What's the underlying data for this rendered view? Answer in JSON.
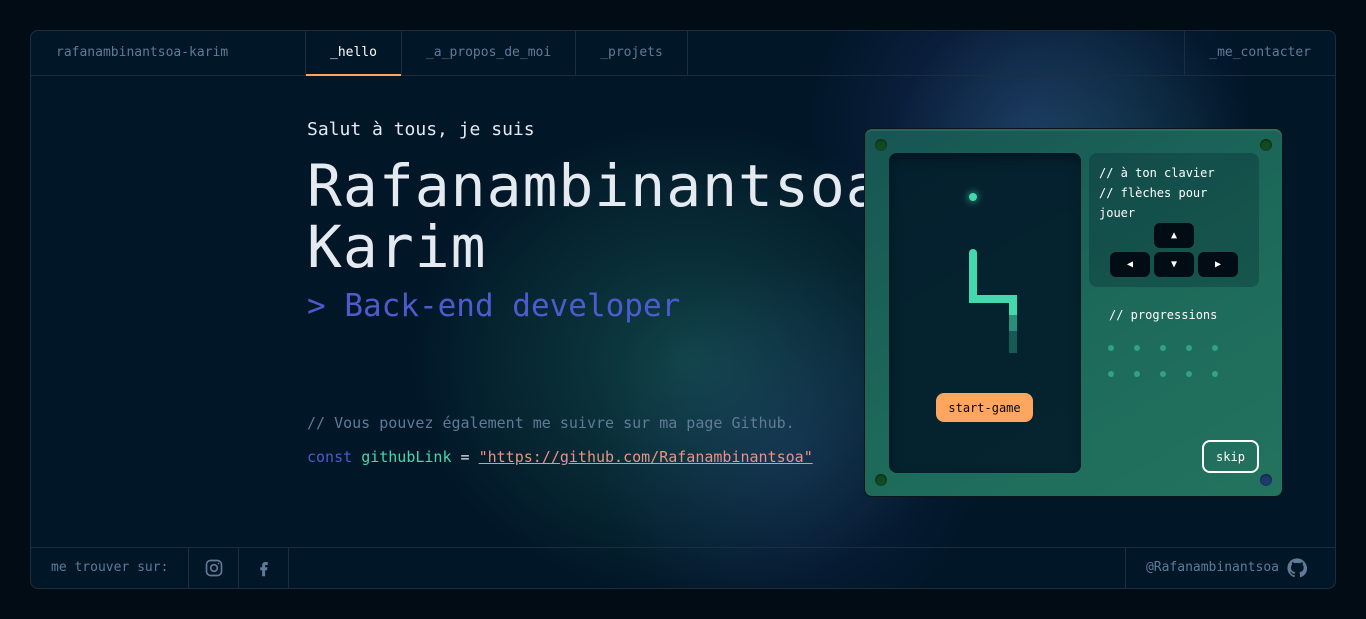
{
  "header": {
    "brand": "rafanambinantsoa-karim",
    "tabs": [
      "_hello",
      "_a_propos_de_moi",
      "_projets"
    ],
    "contact": "_me_contacter"
  },
  "hero": {
    "greeting": "Salut à tous, je suis",
    "name_line1": "Rafanambinantsoa",
    "name_line2": "Karim",
    "role": "> Back-end developer",
    "comment": "// Vous pouvez également me suivre sur ma page Github.",
    "code_keyword": "const",
    "code_var": "githubLink",
    "code_eq": "=",
    "code_string": "\"https://github.com/Rafanambinantsoa\""
  },
  "game": {
    "instructions_line1": "// à ton clavier",
    "instructions_line2": "// flèches pour jouer",
    "key_up": "▲",
    "key_left": "◀",
    "key_down": "▼",
    "key_right": "▶",
    "progress_title": "// progressions",
    "start_label": "start-game",
    "skip_label": "skip"
  },
  "footer": {
    "find_me": "me trouver sur:",
    "github_handle": "@Rafanambinantsoa"
  },
  "colors": {
    "accent_orange": "#fea55f",
    "accent_green": "#43d9ad",
    "accent_blue": "#4d5bce",
    "link": "#e99287",
    "bg": "#011627"
  }
}
